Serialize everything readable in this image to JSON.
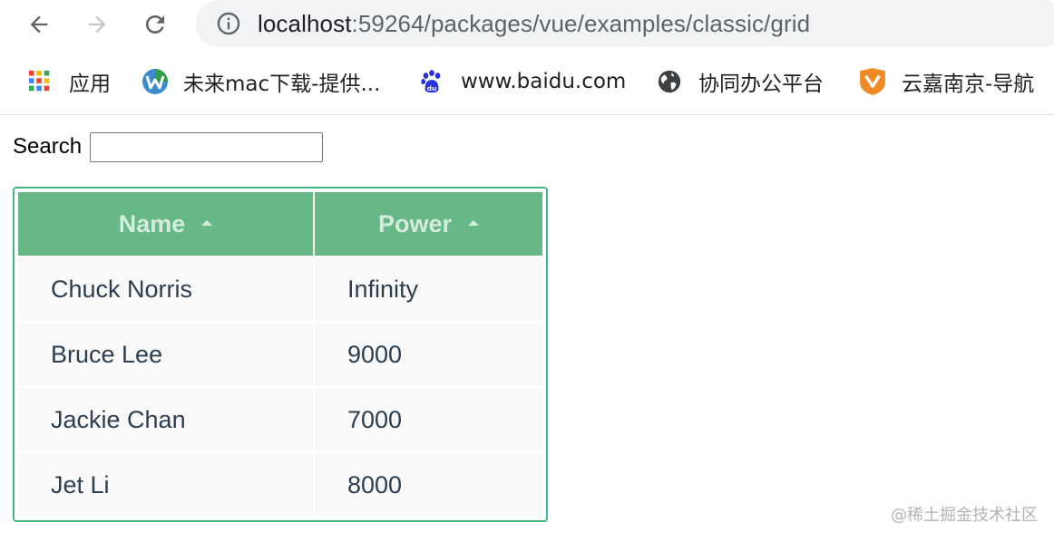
{
  "browser": {
    "url_host": "localhost",
    "url_path": ":59264/packages/vue/examples/classic/grid"
  },
  "bookmarks": [
    {
      "label": "应用",
      "icon": "apps-grid-icon"
    },
    {
      "label": "未来mac下载-提供...",
      "icon": "wlmac-logo-icon"
    },
    {
      "label": "www.baidu.com",
      "icon": "baidu-paw-icon"
    },
    {
      "label": "协同办公平台",
      "icon": "globe-icon"
    },
    {
      "label": "云嘉南京-导航",
      "icon": "shield-logo-icon"
    }
  ],
  "search": {
    "label": "Search",
    "value": ""
  },
  "grid": {
    "columns": [
      {
        "label": "Name",
        "sort": "asc"
      },
      {
        "label": "Power",
        "sort": "asc"
      }
    ],
    "rows": [
      {
        "name": "Chuck Norris",
        "power": "Infinity"
      },
      {
        "name": "Bruce Lee",
        "power": "9000"
      },
      {
        "name": "Jackie Chan",
        "power": "7000"
      },
      {
        "name": "Jet Li",
        "power": "8000"
      }
    ]
  },
  "watermark": "@稀土掘金技术社区",
  "colors": {
    "accent": "#42b983",
    "header_bg": "#66b887",
    "row_bg": "#f9f9f9"
  }
}
